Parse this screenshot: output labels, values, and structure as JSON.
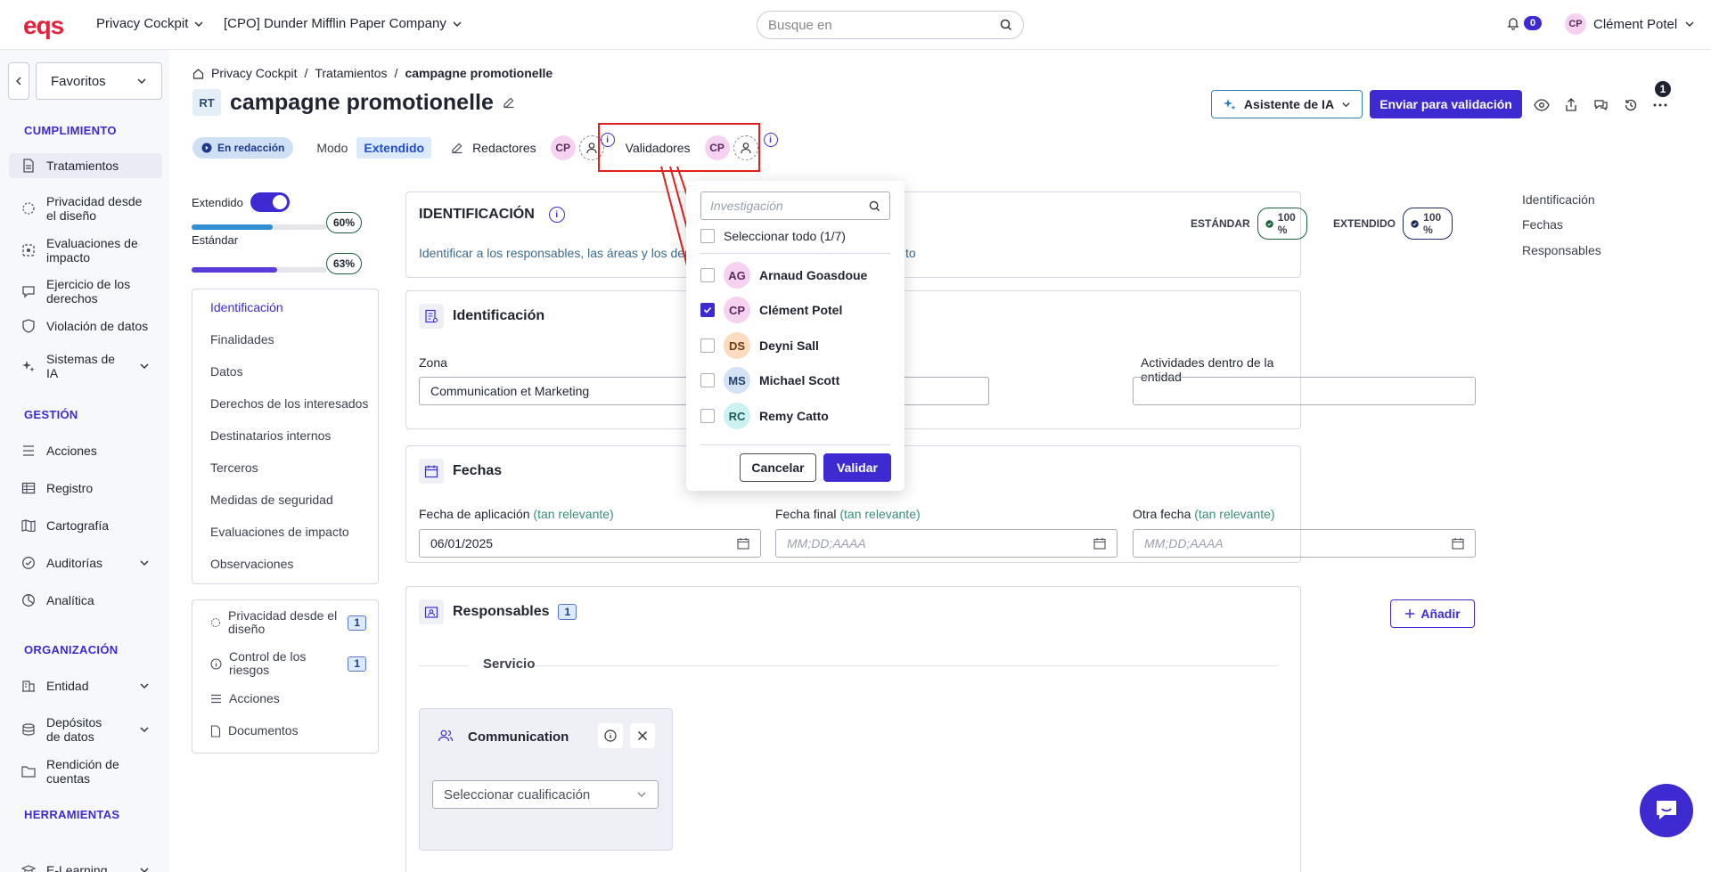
{
  "topbar": {
    "logo": "eqs",
    "app_menu": "Privacy Cockpit",
    "company_menu": "[CPO] Dunder Mifflin Paper Company",
    "search_placeholder": "Busque en",
    "notifications_count": "0",
    "user_initials": "CP",
    "user_name": "Clément Potel"
  },
  "sidebar": {
    "favorites": "Favoritos",
    "sections": [
      {
        "title": "CUMPLIMIENTO"
      },
      {
        "title": "GESTIÓN"
      },
      {
        "title": "ORGANIZACIÓN"
      },
      {
        "title": "HERRAMIENTAS"
      }
    ],
    "items": [
      {
        "label": "Tratamientos"
      },
      {
        "label": "Privacidad desde el diseño"
      },
      {
        "label": "Evaluaciones de impacto"
      },
      {
        "label": "Ejercicio de los derechos"
      },
      {
        "label": "Violación de datos"
      },
      {
        "label": "Sistemas de IA"
      },
      {
        "label": "Acciones"
      },
      {
        "label": "Registro"
      },
      {
        "label": "Cartografía"
      },
      {
        "label": "Auditorías"
      },
      {
        "label": "Analítica"
      },
      {
        "label": "Entidad"
      },
      {
        "label": "Depósitos de datos"
      },
      {
        "label": "Rendición de cuentas"
      },
      {
        "label": "E-Learning"
      }
    ]
  },
  "breadcrumb": {
    "home": "Privacy Cockpit",
    "level2": "Tratamientos",
    "current": "campagne promotionelle"
  },
  "header": {
    "type_badge": "RT",
    "title": "campagne promotionelle",
    "ai_button": "Asistente de IA",
    "submit_button": "Enviar para validación",
    "history_count": "1"
  },
  "status": {
    "state": "En redacción",
    "mode_label": "Modo",
    "mode_value": "Extendido",
    "editors_label": "Redactores",
    "editors_initials": "CP",
    "validators_label": "Validadores",
    "validators_initials": "CP"
  },
  "progress": {
    "extended_label": "Extendido",
    "extended_pct": "60%",
    "extended_value": 0.6,
    "standard_label": "Estándar",
    "standard_pct": "63%",
    "standard_value": 0.63,
    "extended_color": "#2f8fd1",
    "standard_color": "#5b3bd9"
  },
  "nav": {
    "items": [
      "Identificación",
      "Finalidades",
      "Datos",
      "Derechos de los interesados",
      "Destinatarios internos",
      "Terceros",
      "Medidas de seguridad",
      "Evaluaciones de impacto",
      "Observaciones"
    ]
  },
  "side_card": {
    "privacy_label": "Privacidad desde el diseño",
    "privacy_count": "1",
    "risk_label": "Control de los riesgos",
    "risk_count": "1",
    "actions_label": "Acciones",
    "documents_label": "Documentos"
  },
  "identification_card": {
    "title": "IDENTIFICACIÓN",
    "description": "Identificar a los responsables, las áreas y los der",
    "description_tail": "to",
    "standard_label": "ESTÁNDAR",
    "standard_pct": "100 %",
    "extended_label": "EXTENDIDO",
    "extended_pct": "100 %"
  },
  "ident_section": {
    "title": "Identificación",
    "zone_label": "Zona",
    "zone_value": "Communication et Marketing",
    "activities_label": "Actividades dentro de la entidad"
  },
  "dates_section": {
    "title": "Fechas",
    "app_label": "Fecha de aplicación",
    "final_label": "Fecha final",
    "other_label": "Otra fecha",
    "qualifier": "(tan relevante)",
    "app_value": "06/01/2025",
    "placeholder": "MM;DD;AAAA"
  },
  "responsables": {
    "title": "Responsables",
    "count": "1",
    "add_button": "Añadir",
    "service_label": "Servicio",
    "item_name": "Communication",
    "qualification_placeholder": "Seleccionar cualificación"
  },
  "right_nav": [
    "Identificación",
    "Fechas",
    "Responsables"
  ],
  "popup": {
    "search_placeholder": "Investigación",
    "select_all": "Seleccionar todo (1/7)",
    "users": [
      {
        "initials": "AG",
        "name": "Arnaud Goasdoue",
        "checked": false
      },
      {
        "initials": "CP",
        "name": "Clément Potel",
        "checked": true
      },
      {
        "initials": "DS",
        "name": "Deyni Sall",
        "checked": false
      },
      {
        "initials": "MS",
        "name": "Michael Scott",
        "checked": false
      },
      {
        "initials": "RC",
        "name": "Remy Catto",
        "checked": false
      }
    ],
    "cancel": "Cancelar",
    "validate": "Validar"
  }
}
